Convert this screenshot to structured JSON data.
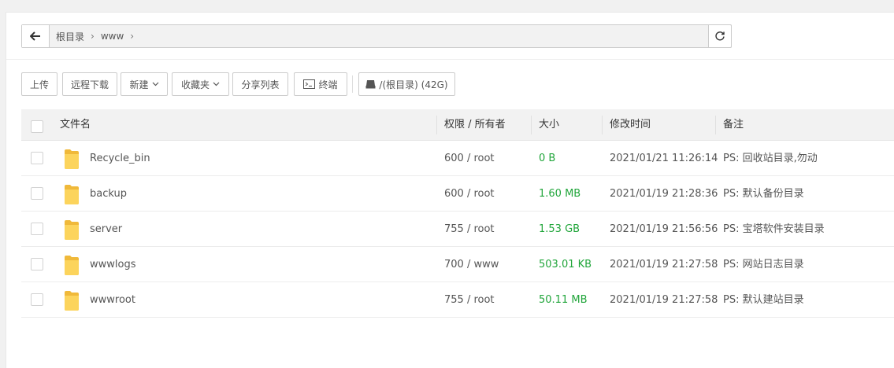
{
  "breadcrumb": {
    "items": [
      "根目录",
      "www"
    ],
    "separator": "›"
  },
  "toolbar": {
    "upload": "上传",
    "remote_download": "远程下载",
    "new": "新建",
    "favorites": "收藏夹",
    "share_list": "分享列表",
    "terminal": "终端",
    "disk": "/(根目录) (42G)"
  },
  "table": {
    "headers": {
      "name": "文件名",
      "perm": "权限 / 所有者",
      "size": "大小",
      "mtime": "修改时间",
      "note": "备注"
    },
    "rows": [
      {
        "name": "Recycle_bin",
        "perm": "600 / root",
        "size": "0 B",
        "mtime": "2021/01/21 11:26:14",
        "note": "PS: 回收站目录,勿动"
      },
      {
        "name": "backup",
        "perm": "600 / root",
        "size": "1.60 MB",
        "mtime": "2021/01/19 21:28:36",
        "note": "PS: 默认备份目录"
      },
      {
        "name": "server",
        "perm": "755 / root",
        "size": "1.53 GB",
        "mtime": "2021/01/19 21:56:56",
        "note": "PS: 宝塔软件安装目录"
      },
      {
        "name": "wwwlogs",
        "perm": "700 / www",
        "size": "503.01 KB",
        "mtime": "2021/01/19 21:27:58",
        "note": "PS: 网站日志目录"
      },
      {
        "name": "wwwroot",
        "perm": "755 / root",
        "size": "50.11 MB",
        "mtime": "2021/01/19 21:27:58",
        "note": "PS: 默认建站目录"
      }
    ]
  },
  "colors": {
    "size_green": "#20a53a",
    "folder_yellow": "#f5c542"
  },
  "icons": {
    "back": "arrow-left-icon",
    "refresh": "refresh-icon",
    "terminal": "terminal-icon",
    "disk": "disk-icon",
    "folder": "folder-icon",
    "dropdown": "chevron-down-icon"
  }
}
